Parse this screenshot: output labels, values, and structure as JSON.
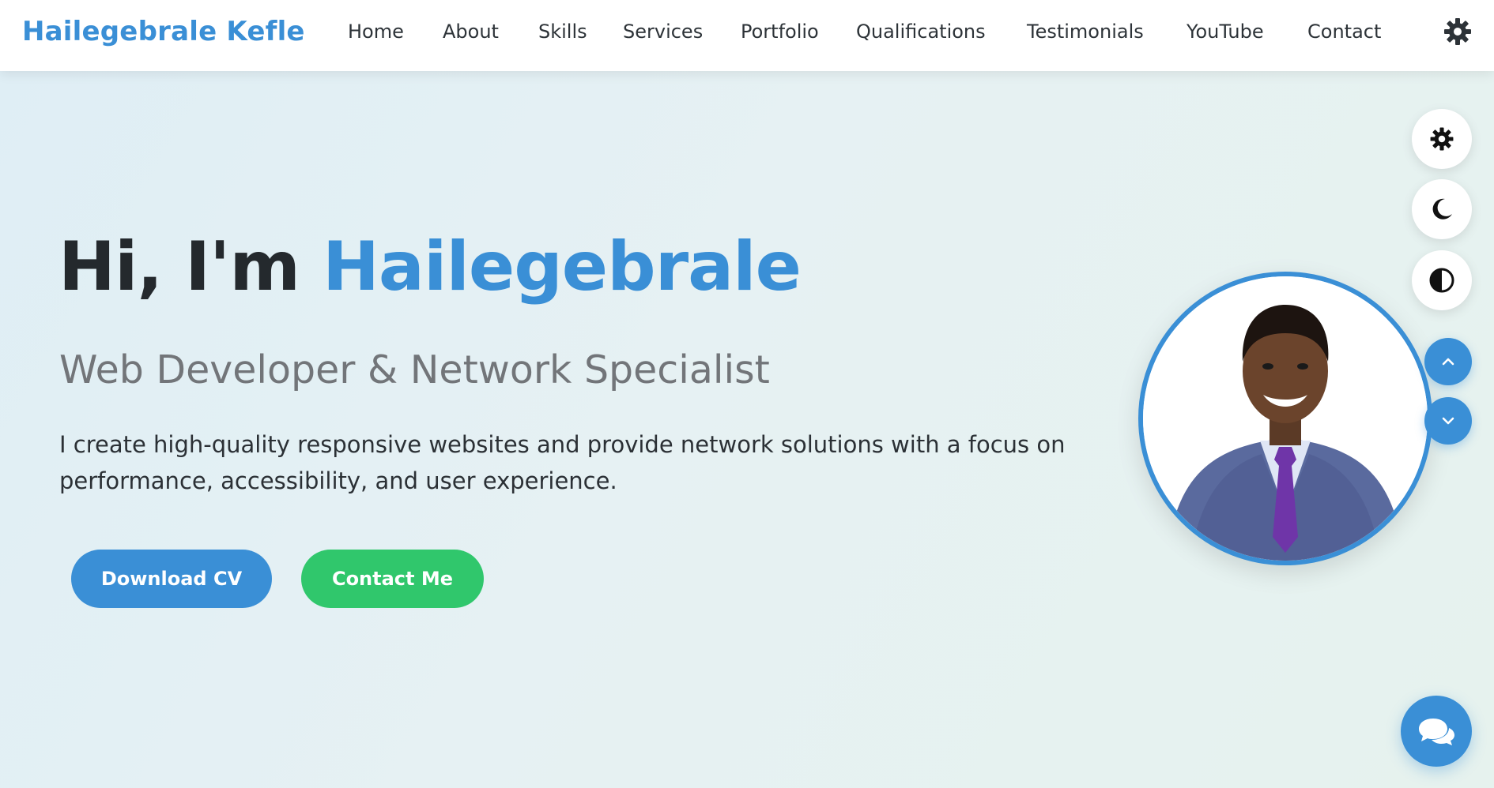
{
  "header": {
    "brand": "Hailegebrale Kefle",
    "nav": [
      {
        "label": "Home"
      },
      {
        "label": "About"
      },
      {
        "label": "Skills"
      },
      {
        "label": "Services"
      },
      {
        "label": "Portfolio"
      },
      {
        "label": "Qualifications"
      },
      {
        "label": "Testimonials"
      },
      {
        "label": "YouTube"
      },
      {
        "label": "Contact"
      }
    ],
    "theme_icon": "gear-icon"
  },
  "hero": {
    "greeting": "Hi, I'm ",
    "name": "Hailegebrale",
    "subtitle": "Web Developer & Network Specialist",
    "description": "I create high-quality responsive websites and provide network solutions with a focus on performance, accessibility, and user experience.",
    "buttons": {
      "download_cv": "Download CV",
      "contact_me": "Contact Me"
    }
  },
  "floating_controls": {
    "theme_buttons": [
      "gear-icon",
      "moon-icon",
      "contrast-icon"
    ],
    "scroll_buttons": [
      "chevron-up-icon",
      "chevron-down-icon"
    ],
    "chat_icon": "chat-icon"
  },
  "colors": {
    "accent": "#3a8fd6",
    "success": "#30c76c",
    "text_dark": "#24292d",
    "text_muted": "#727579"
  }
}
